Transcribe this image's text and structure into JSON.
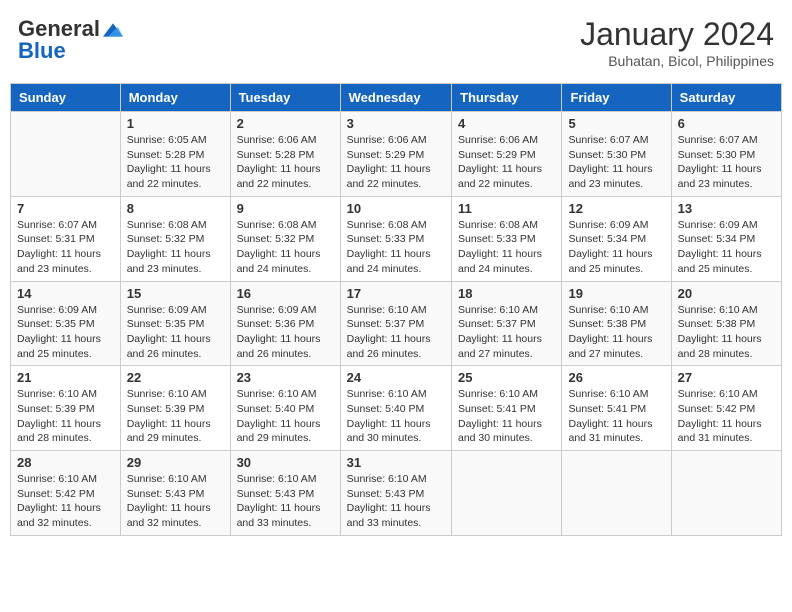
{
  "header": {
    "logo_general": "General",
    "logo_blue": "Blue",
    "month": "January 2024",
    "location": "Buhatan, Bicol, Philippines"
  },
  "weekdays": [
    "Sunday",
    "Monday",
    "Tuesday",
    "Wednesday",
    "Thursday",
    "Friday",
    "Saturday"
  ],
  "weeks": [
    [
      {
        "day": "",
        "info": ""
      },
      {
        "day": "1",
        "info": "Sunrise: 6:05 AM\nSunset: 5:28 PM\nDaylight: 11 hours\nand 22 minutes."
      },
      {
        "day": "2",
        "info": "Sunrise: 6:06 AM\nSunset: 5:28 PM\nDaylight: 11 hours\nand 22 minutes."
      },
      {
        "day": "3",
        "info": "Sunrise: 6:06 AM\nSunset: 5:29 PM\nDaylight: 11 hours\nand 22 minutes."
      },
      {
        "day": "4",
        "info": "Sunrise: 6:06 AM\nSunset: 5:29 PM\nDaylight: 11 hours\nand 22 minutes."
      },
      {
        "day": "5",
        "info": "Sunrise: 6:07 AM\nSunset: 5:30 PM\nDaylight: 11 hours\nand 23 minutes."
      },
      {
        "day": "6",
        "info": "Sunrise: 6:07 AM\nSunset: 5:30 PM\nDaylight: 11 hours\nand 23 minutes."
      }
    ],
    [
      {
        "day": "7",
        "info": "Sunrise: 6:07 AM\nSunset: 5:31 PM\nDaylight: 11 hours\nand 23 minutes."
      },
      {
        "day": "8",
        "info": "Sunrise: 6:08 AM\nSunset: 5:32 PM\nDaylight: 11 hours\nand 23 minutes."
      },
      {
        "day": "9",
        "info": "Sunrise: 6:08 AM\nSunset: 5:32 PM\nDaylight: 11 hours\nand 24 minutes."
      },
      {
        "day": "10",
        "info": "Sunrise: 6:08 AM\nSunset: 5:33 PM\nDaylight: 11 hours\nand 24 minutes."
      },
      {
        "day": "11",
        "info": "Sunrise: 6:08 AM\nSunset: 5:33 PM\nDaylight: 11 hours\nand 24 minutes."
      },
      {
        "day": "12",
        "info": "Sunrise: 6:09 AM\nSunset: 5:34 PM\nDaylight: 11 hours\nand 25 minutes."
      },
      {
        "day": "13",
        "info": "Sunrise: 6:09 AM\nSunset: 5:34 PM\nDaylight: 11 hours\nand 25 minutes."
      }
    ],
    [
      {
        "day": "14",
        "info": "Sunrise: 6:09 AM\nSunset: 5:35 PM\nDaylight: 11 hours\nand 25 minutes."
      },
      {
        "day": "15",
        "info": "Sunrise: 6:09 AM\nSunset: 5:35 PM\nDaylight: 11 hours\nand 26 minutes."
      },
      {
        "day": "16",
        "info": "Sunrise: 6:09 AM\nSunset: 5:36 PM\nDaylight: 11 hours\nand 26 minutes."
      },
      {
        "day": "17",
        "info": "Sunrise: 6:10 AM\nSunset: 5:37 PM\nDaylight: 11 hours\nand 26 minutes."
      },
      {
        "day": "18",
        "info": "Sunrise: 6:10 AM\nSunset: 5:37 PM\nDaylight: 11 hours\nand 27 minutes."
      },
      {
        "day": "19",
        "info": "Sunrise: 6:10 AM\nSunset: 5:38 PM\nDaylight: 11 hours\nand 27 minutes."
      },
      {
        "day": "20",
        "info": "Sunrise: 6:10 AM\nSunset: 5:38 PM\nDaylight: 11 hours\nand 28 minutes."
      }
    ],
    [
      {
        "day": "21",
        "info": "Sunrise: 6:10 AM\nSunset: 5:39 PM\nDaylight: 11 hours\nand 28 minutes."
      },
      {
        "day": "22",
        "info": "Sunrise: 6:10 AM\nSunset: 5:39 PM\nDaylight: 11 hours\nand 29 minutes."
      },
      {
        "day": "23",
        "info": "Sunrise: 6:10 AM\nSunset: 5:40 PM\nDaylight: 11 hours\nand 29 minutes."
      },
      {
        "day": "24",
        "info": "Sunrise: 6:10 AM\nSunset: 5:40 PM\nDaylight: 11 hours\nand 30 minutes."
      },
      {
        "day": "25",
        "info": "Sunrise: 6:10 AM\nSunset: 5:41 PM\nDaylight: 11 hours\nand 30 minutes."
      },
      {
        "day": "26",
        "info": "Sunrise: 6:10 AM\nSunset: 5:41 PM\nDaylight: 11 hours\nand 31 minutes."
      },
      {
        "day": "27",
        "info": "Sunrise: 6:10 AM\nSunset: 5:42 PM\nDaylight: 11 hours\nand 31 minutes."
      }
    ],
    [
      {
        "day": "28",
        "info": "Sunrise: 6:10 AM\nSunset: 5:42 PM\nDaylight: 11 hours\nand 32 minutes."
      },
      {
        "day": "29",
        "info": "Sunrise: 6:10 AM\nSunset: 5:43 PM\nDaylight: 11 hours\nand 32 minutes."
      },
      {
        "day": "30",
        "info": "Sunrise: 6:10 AM\nSunset: 5:43 PM\nDaylight: 11 hours\nand 33 minutes."
      },
      {
        "day": "31",
        "info": "Sunrise: 6:10 AM\nSunset: 5:43 PM\nDaylight: 11 hours\nand 33 minutes."
      },
      {
        "day": "",
        "info": ""
      },
      {
        "day": "",
        "info": ""
      },
      {
        "day": "",
        "info": ""
      }
    ]
  ]
}
